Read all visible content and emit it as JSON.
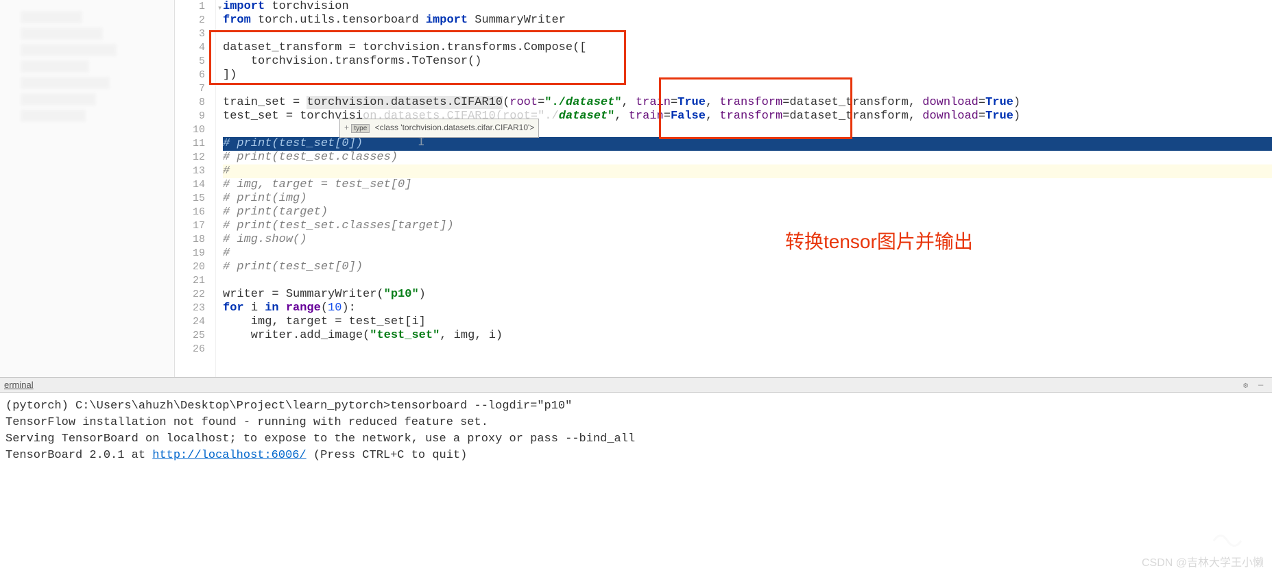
{
  "gutter": [
    "1",
    "2",
    "3",
    "4",
    "5",
    "6",
    "7",
    "8",
    "9",
    "10",
    "11",
    "12",
    "13",
    "14",
    "15",
    "16",
    "17",
    "18",
    "19",
    "20",
    "21",
    "22",
    "23",
    "24",
    "25",
    "26"
  ],
  "code": {
    "l1_kw1": "import",
    "l1_mod": "torchvision",
    "l2_kw1": "from",
    "l2_mod": "torch.utils.tensorboard",
    "l2_kw2": "import",
    "l2_name": "SummaryWriter",
    "l4": "dataset_transform = torchvision.transforms.Compose([",
    "l5": "    torchvision.transforms.ToTensor()",
    "l6": "])",
    "l8_a": "train_set = ",
    "l8_b": "torchvision.datasets.CIFAR10",
    "l8_c": "(",
    "l8_p1": "root",
    "l8_v1": "\"./",
    "l8_v1b": "dataset",
    "l8_v1c": "\"",
    "l8_p2": "train",
    "l8_v2": "True",
    "l8_p3": "transform",
    "l8_v3": "dataset_transform",
    "l8_p4": "download",
    "l8_v4": "True",
    "l9_a": "test_set = torchvisi",
    "l9_b_hidden": "on.datasets.CIFAR10(root=\"./",
    "l9_c": "dataset",
    "l9_d": "\"",
    "l9_p2": "train",
    "l9_v2": "False",
    "l9_p3": "transform",
    "l9_v3": "dataset_transform",
    "l9_p4": "download",
    "l9_v4": "True",
    "l11": "# print(test_set[0])",
    "l12": "# print(test_set.classes)",
    "l13": "#",
    "l14": "# img, target = test_set[0]",
    "l15": "# print(img)",
    "l16": "# print(target)",
    "l17": "# print(test_set.classes[target])",
    "l18": "# img.show()",
    "l19": "#",
    "l20": "# print(test_set[0])",
    "l22_a": "writer = SummaryWriter(",
    "l22_s": "\"p10\"",
    "l22_b": ")",
    "l23_kw1": "for",
    "l23_var": "i",
    "l23_kw2": "in",
    "l23_fn": "range",
    "l23_num": "10",
    "l24": "    img, target = test_set[i]",
    "l25_a": "    writer.add_image(",
    "l25_s": "\"test_set\"",
    "l25_b": ", img, i)"
  },
  "tooltip": {
    "badge": "type",
    "text": "<class 'torchvision.datasets.cifar.CIFAR10'>"
  },
  "annotation": "转换tensor图片并输出",
  "terminal": {
    "tab": "erminal",
    "line1": "(pytorch) C:\\Users\\ahuzh\\Desktop\\Project\\learn_pytorch>tensorboard --logdir=\"p10\"",
    "line2": "TensorFlow installation not found - running with reduced feature set.",
    "line3": "Serving TensorBoard on localhost; to expose to the network, use a proxy or pass --bind_all",
    "line4_a": "TensorBoard 2.0.1 at ",
    "line4_link": "http://localhost:6006/",
    "line4_b": " (Press CTRL+C to quit)"
  },
  "watermark": "CSDN @吉林大学王小懒"
}
